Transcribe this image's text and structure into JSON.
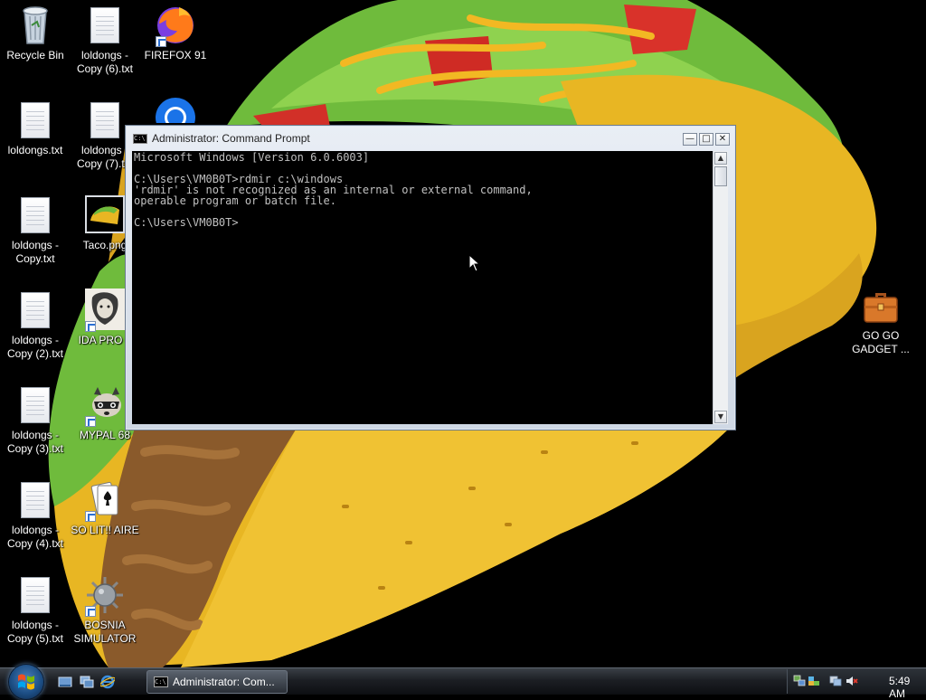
{
  "desktop": {
    "icons": [
      {
        "label": "Recycle Bin"
      },
      {
        "label": "loldongs - Copy (6).txt"
      },
      {
        "label": "FIREFOX 91"
      },
      {
        "label": "loldongs.txt"
      },
      {
        "label": "loldongs - Copy (7).txt"
      },
      {
        "label": "loldongs - Copy.txt"
      },
      {
        "label": "Taco.png"
      },
      {
        "label": "loldongs - Copy (2).txt"
      },
      {
        "label": "IDA PRO 6"
      },
      {
        "label": "loldongs - Copy (3).txt"
      },
      {
        "label": "MYPAL 68"
      },
      {
        "label": "loldongs - Copy (4).txt"
      },
      {
        "label": "SO LIT!! AIRE"
      },
      {
        "label": "loldongs - Copy (5).txt"
      },
      {
        "label": "BOSNIA SIMULATOR"
      },
      {
        "label": "GO GO GADGET ..."
      }
    ]
  },
  "cmd_window": {
    "title": "Administrator: Command Prompt",
    "title_icon_text": "C:\\",
    "minimize_glyph": "—",
    "maximize_glyph": "□",
    "close_glyph": "✕",
    "console_output": "Microsoft Windows [Version 6.0.6003]\n\nC:\\Users\\VM0B0T>rdmir c:\\windows\n'rdmir' is not recognized as an internal or external command,\noperable program or batch file.\n\nC:\\Users\\VM0B0T>",
    "scroll_up_glyph": "▲",
    "scroll_down_glyph": "▼"
  },
  "taskbar": {
    "task_buttons": [
      {
        "label": "Administrator: Com...",
        "icon_text": "C:\\"
      }
    ],
    "quick_launch": [
      "show-desktop-icon",
      "switch-windows-icon",
      "internet-explorer-icon"
    ],
    "clock": "5:49 AM"
  },
  "colors": {
    "console_bg": "#000000",
    "console_text": "#c0c0c0",
    "taco_shell": "#e8b623",
    "lettuce": "#7cc242",
    "tomato": "#d9322a",
    "cheese": "#f2b823"
  }
}
